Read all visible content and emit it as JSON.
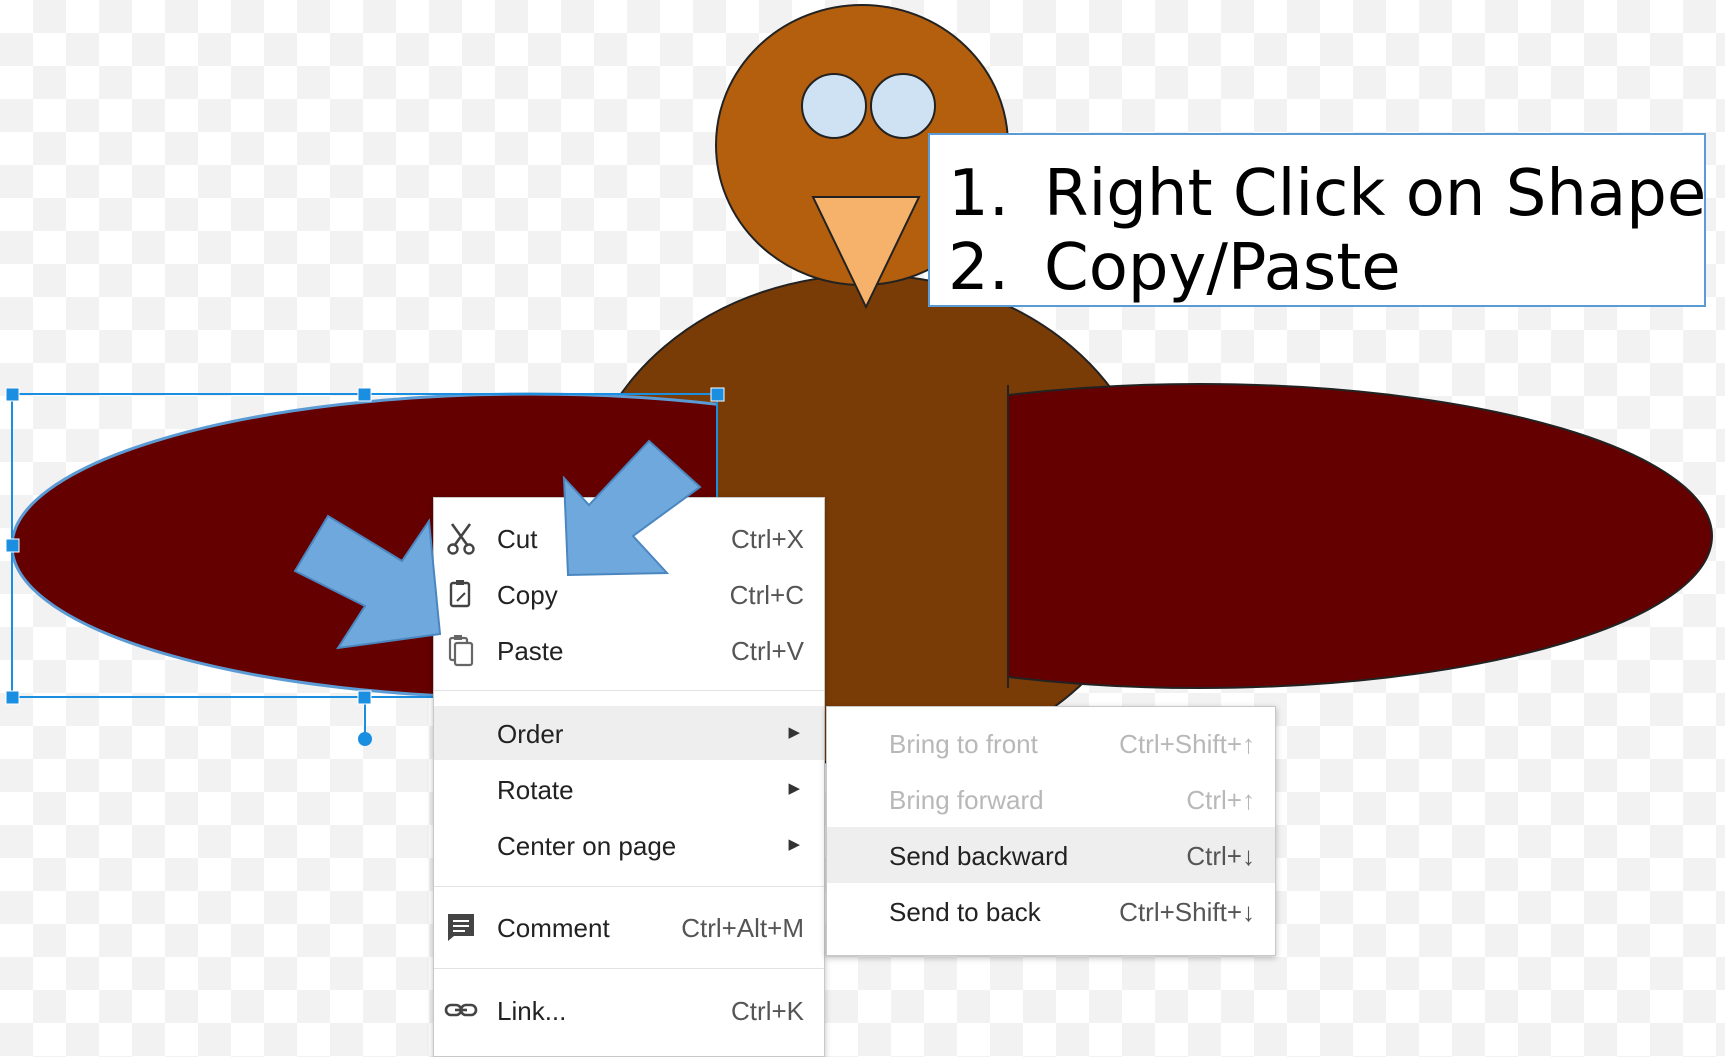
{
  "callout": {
    "items": [
      {
        "num": "1.",
        "text": "Right Click on Shape"
      },
      {
        "num": "2.",
        "text": "Copy/Paste"
      }
    ]
  },
  "context_menu": {
    "cut": {
      "label": "Cut",
      "shortcut": "Ctrl+X",
      "icon": "scissors-icon"
    },
    "copy": {
      "label": "Copy",
      "shortcut": "Ctrl+C",
      "icon": "copy-icon"
    },
    "paste": {
      "label": "Paste",
      "shortcut": "Ctrl+V",
      "icon": "paste-icon"
    },
    "order": {
      "label": "Order"
    },
    "rotate": {
      "label": "Rotate"
    },
    "center": {
      "label": "Center on page"
    },
    "comment": {
      "label": "Comment",
      "shortcut": "Ctrl+Alt+M",
      "icon": "comment-icon"
    },
    "link": {
      "label": "Link...",
      "shortcut": "Ctrl+K",
      "icon": "link-icon"
    }
  },
  "order_submenu": {
    "bring_to_front": {
      "label": "Bring to front",
      "shortcut": "Ctrl+Shift+↑",
      "disabled": true
    },
    "bring_forward": {
      "label": "Bring forward",
      "shortcut": "Ctrl+↑",
      "disabled": true
    },
    "send_backward": {
      "label": "Send backward",
      "shortcut": "Ctrl+↓"
    },
    "send_to_back": {
      "label": "Send to back",
      "shortcut": "Ctrl+Shift+↓"
    }
  },
  "colors": {
    "head": "#b35f0e",
    "body": "#7a3c06",
    "wing": "#640000",
    "beak": "#f6b26b",
    "eye": "#cfe2f3",
    "selection": "#1a8ee0",
    "arrow": "#6fa8dc",
    "callout_border": "#5b9bd5"
  }
}
